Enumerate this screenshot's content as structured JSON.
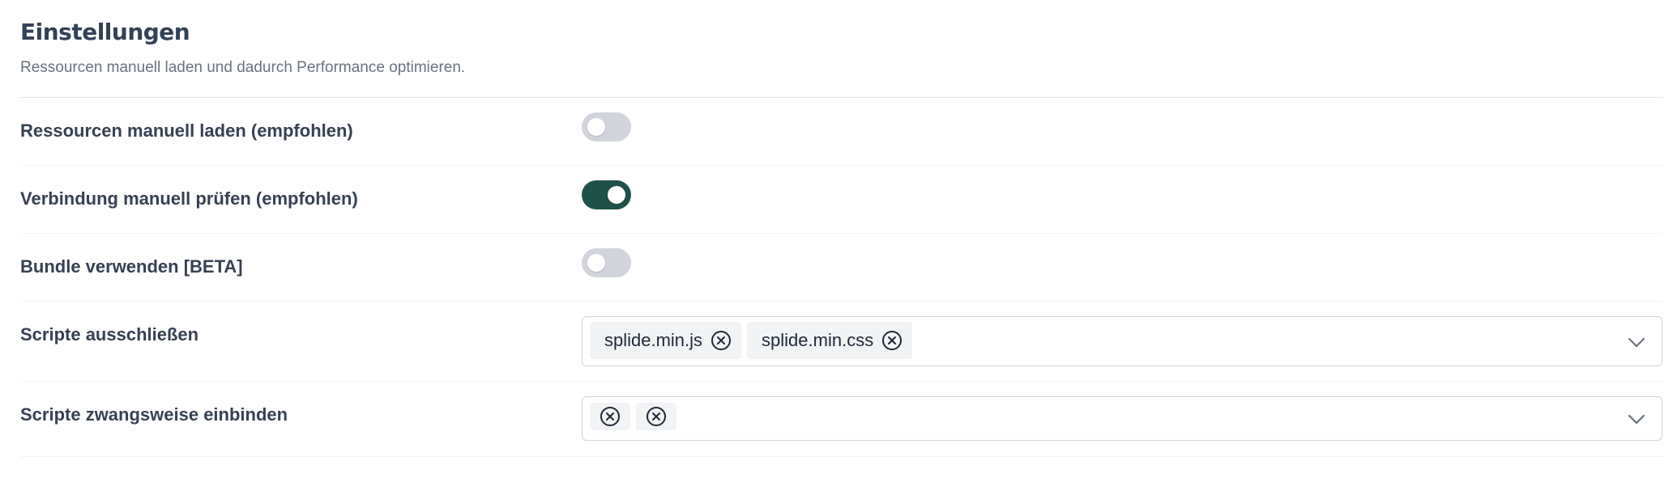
{
  "header": {
    "title": "Einstellungen",
    "subtitle": "Ressourcen manuell laden und dadurch Performance optimieren."
  },
  "settings": {
    "manual_load": {
      "label": "Ressourcen manuell laden (empfohlen)",
      "enabled": false
    },
    "manual_check": {
      "label": "Verbindung manuell prüfen (empfohlen)",
      "enabled": true
    },
    "bundle": {
      "label": "Bundle verwenden [BETA]",
      "enabled": false
    },
    "exclude_scripts": {
      "label": "Scripte ausschließen",
      "tags": [
        "splide.min.js",
        "splide.min.css"
      ]
    },
    "force_scripts": {
      "label": "Scripte zwangsweise einbinden",
      "tags": [
        "",
        ""
      ]
    }
  },
  "colors": {
    "toggle_on": "#1f5148",
    "toggle_off": "#d1d5db",
    "tag_bg": "#f1f3f5"
  },
  "icons": {
    "tag_remove": "circle-x-icon",
    "dropdown": "chevron-down-icon"
  }
}
